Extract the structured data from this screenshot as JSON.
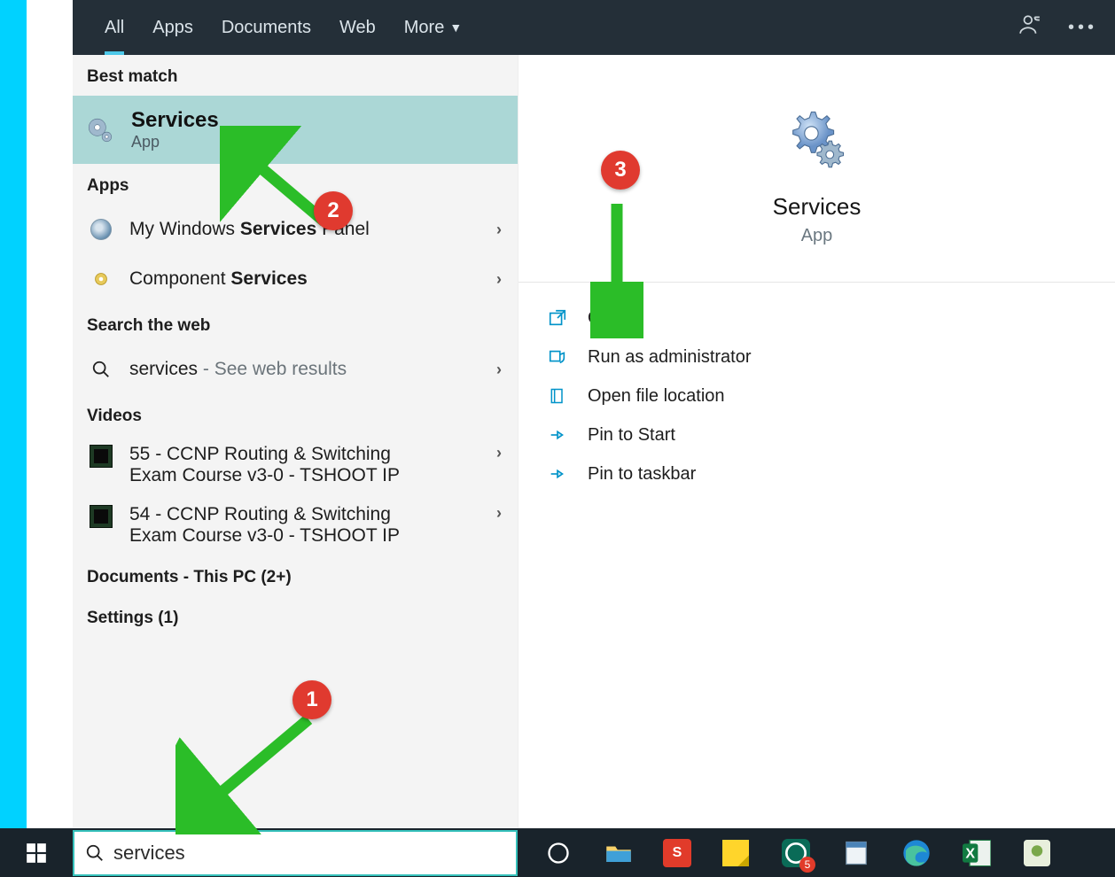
{
  "tabs": {
    "all": "All",
    "apps": "Apps",
    "documents": "Documents",
    "web": "Web",
    "more": "More"
  },
  "sections": {
    "best_match": "Best match",
    "apps": "Apps",
    "search_web": "Search the web",
    "videos": "Videos",
    "documents_pc": "Documents - This PC (2+)",
    "settings": "Settings (1)"
  },
  "best_match": {
    "title": "Services",
    "subtitle": "App"
  },
  "apps_results": {
    "r1_pre": "My Windows ",
    "r1_hl": "Services",
    "r1_post": " Panel",
    "r2_pre": "Component ",
    "r2_hl": "Services"
  },
  "web_result": {
    "term": "services",
    "hint": " - See web results"
  },
  "videos_results": {
    "v1_line1": "55 - CCNP Routing & Switching",
    "v1_line2": "Exam Course v3-0 - TSHOOT IP",
    "v2_line1": "54 - CCNP Routing & Switching",
    "v2_line2": "Exam Course v3-0 - TSHOOT IP"
  },
  "preview": {
    "title": "Services",
    "subtitle": "App"
  },
  "actions": {
    "open": "Open",
    "run_admin": "Run as administrator",
    "open_loc": "Open file location",
    "pin_start": "Pin to Start",
    "pin_taskbar": "Pin to taskbar"
  },
  "search_input": {
    "value": "services"
  },
  "badges": {
    "b1": "1",
    "b2": "2",
    "b3": "3"
  },
  "taskbar_badge": "5"
}
